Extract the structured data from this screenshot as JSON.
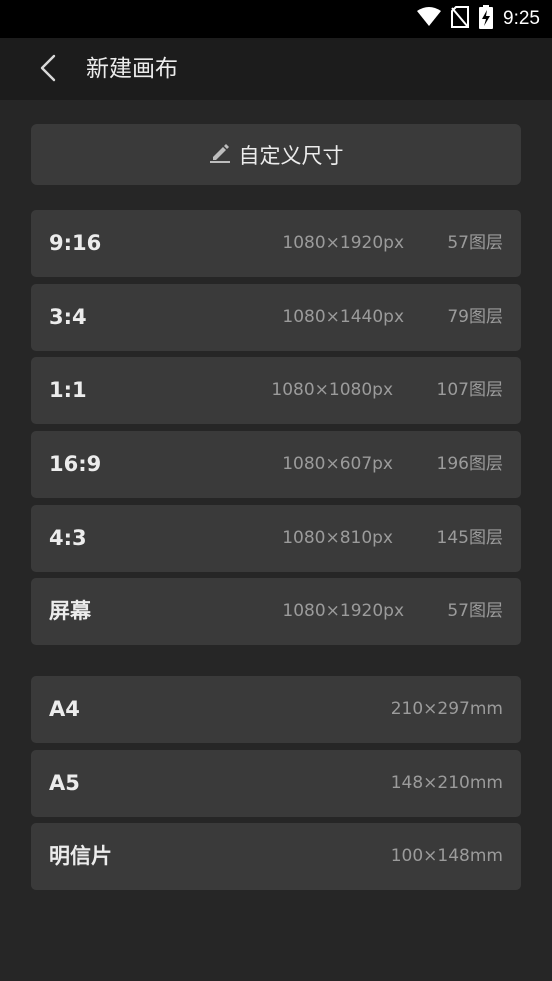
{
  "status_bar": {
    "time": "9:25",
    "icons": [
      "wifi-icon",
      "no-sim-icon",
      "battery-charging-icon"
    ]
  },
  "header": {
    "back_icon": "chevron-left-icon",
    "title": "新建画布"
  },
  "custom_size": {
    "icon": "pencil-icon",
    "label": "自定义尺寸"
  },
  "presets": [
    {
      "name": "9:16",
      "size": "1080×1920px",
      "layers": "57图层"
    },
    {
      "name": "3:4",
      "size": "1080×1440px",
      "layers": "79图层"
    },
    {
      "name": "1:1",
      "size": "1080×1080px",
      "layers": "107图层"
    },
    {
      "name": "16:9",
      "size": "1080×607px",
      "layers": "196图层"
    },
    {
      "name": "4:3",
      "size": "1080×810px",
      "layers": "145图层"
    },
    {
      "name": "屏幕",
      "size": "1080×1920px",
      "layers": "57图层"
    }
  ],
  "paper_sizes": [
    {
      "name": "A4",
      "size": "210×297mm"
    },
    {
      "name": "A5",
      "size": "148×210mm"
    },
    {
      "name": "明信片",
      "size": "100×148mm"
    }
  ]
}
